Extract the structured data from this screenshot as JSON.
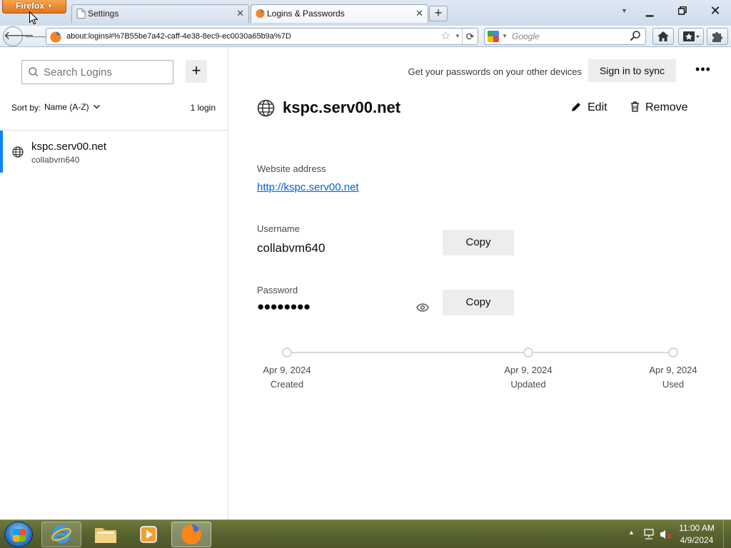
{
  "browser": {
    "menu_button": "Firefox",
    "tabs": [
      {
        "label": "Settings",
        "close": "✕"
      },
      {
        "label": "Logins & Passwords",
        "close": "✕"
      }
    ],
    "new_tab": "+",
    "url": "about:logins#%7B55be7a42-caff-4e38-8ec9-ec0030a65b9a%7D",
    "search_placeholder": "Google"
  },
  "sidebar": {
    "search_placeholder": "Search Logins",
    "create_button": "+",
    "sort_label": "Sort by:",
    "sort_value": "Name (A-Z)",
    "login_count": "1 login",
    "logins": [
      {
        "title": "kspc.serv00.net",
        "username": "collabvm640"
      }
    ]
  },
  "header": {
    "sync_text": "Get your passwords on your other devices",
    "sync_button": "Sign in to sync",
    "menu": "•••"
  },
  "detail": {
    "title": "kspc.serv00.net",
    "edit_label": "Edit",
    "remove_label": "Remove",
    "website_label": "Website address",
    "website_value": "http://kspc.serv00.net",
    "username_label": "Username",
    "username_value": "collabvm640",
    "password_label": "Password",
    "password_value": "●●●●●●●●",
    "copy_label": "Copy",
    "timeline": [
      {
        "date": "Apr 9, 2024",
        "label": "Created"
      },
      {
        "date": "Apr 9, 2024",
        "label": "Updated"
      },
      {
        "date": "Apr 9, 2024",
        "label": "Used"
      }
    ]
  },
  "taskbar": {
    "time": "11:00 AM",
    "date": "4/9/2024"
  },
  "colors": {
    "accent": "#0a84ff",
    "link": "#0060df",
    "button_bg": "#ededf0",
    "firefox_menu": "#e0761e"
  },
  "icons": [
    "globe-icon",
    "search-icon",
    "pencil-icon",
    "trash-icon",
    "eye-icon",
    "home-icon",
    "star-icon",
    "reload-icon"
  ]
}
